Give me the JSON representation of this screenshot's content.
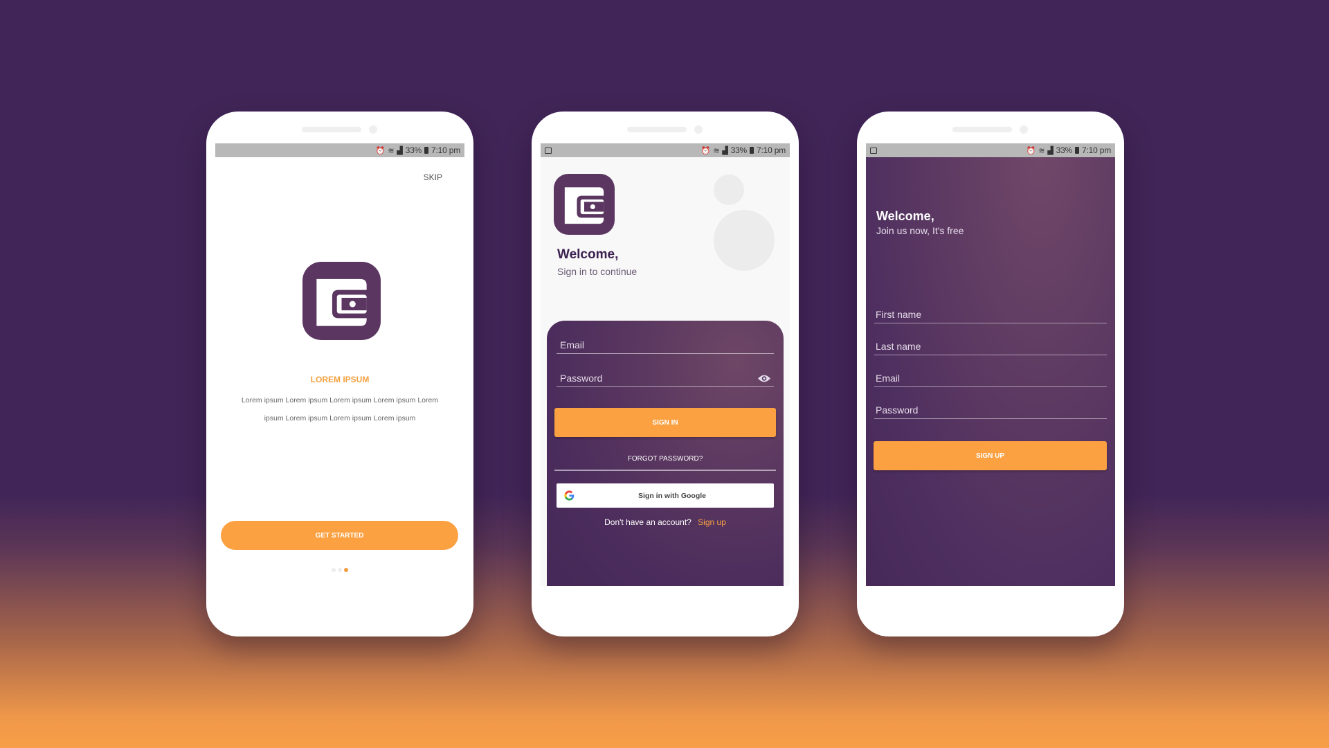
{
  "colors": {
    "brand_purple": "#5a3660",
    "accent_orange": "#fba142",
    "background_top": "#412558",
    "background_bottom": "#f79e47"
  },
  "status_bar": {
    "battery": "33%",
    "time": "7:10 pm"
  },
  "onboarding": {
    "skip_label": "SKIP",
    "logo_icon": "wallet-icon",
    "title": "LOREM IPSUM",
    "body": "Lorem ipsum Lorem ipsum Lorem ipsum Lorem ipsum Lorem ipsum Lorem ipsum Lorem ipsum Lorem ipsum",
    "cta_label": "GET STARTED",
    "pages": 3,
    "active_page": 3
  },
  "signin": {
    "logo_icon": "wallet-icon",
    "welcome": "Welcome,",
    "subtitle": "Sign in to continue",
    "email_placeholder": "Email",
    "password_placeholder": "Password",
    "button_label": "SIGN IN",
    "forgot_label": "FORGOT PASSWORD?",
    "google_label": "Sign in with Google",
    "no_account_text": "Don't have an account?",
    "signup_link": "Sign up"
  },
  "signup": {
    "welcome": "Welcome,",
    "subtitle": "Join us now, It's free",
    "first_name_placeholder": "First name",
    "last_name_placeholder": "Last name",
    "email_placeholder": "Email",
    "password_placeholder": "Password",
    "button_label": "SIGN UP"
  }
}
